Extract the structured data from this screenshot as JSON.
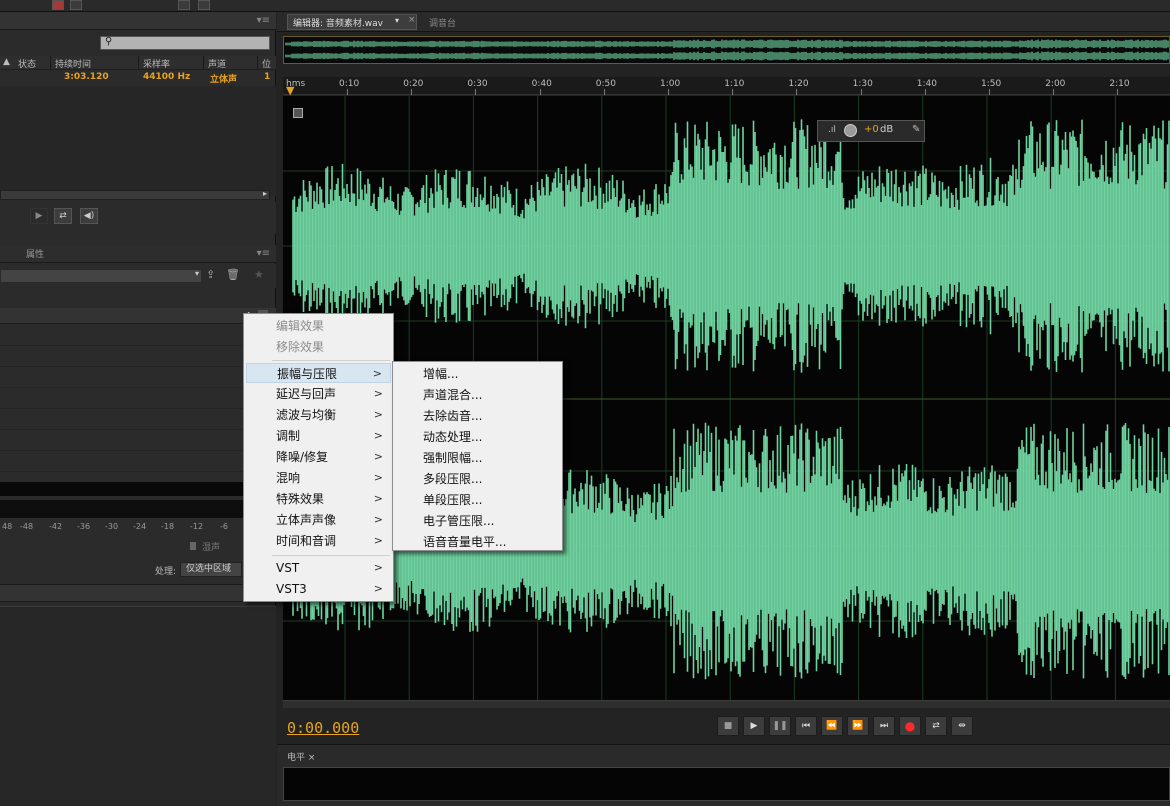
{
  "files_panel": {
    "headers": [
      "状态",
      "持续时间",
      "采样率",
      "声道",
      "位"
    ],
    "row": {
      "duration": "3:03.120",
      "sample_rate": "44100 Hz",
      "channels": "立体声",
      "bits": "1"
    }
  },
  "effects_panel": {
    "tabs": [
      "属性"
    ],
    "mix_label": "湿声",
    "process_label": "处理:",
    "process_value": "仅选中区域"
  },
  "meter_scale_db": [
    "48",
    "-48",
    "-42",
    "-36",
    "-30",
    "-24",
    "-18",
    "-12",
    "-6"
  ],
  "editor": {
    "tab_label": "编辑器: 音频素材.wav",
    "mixer_tab": "调音台",
    "time_readout": "0:00.000",
    "ruler_ticks": [
      "hms",
      "0:10",
      "0:20",
      "0:30",
      "0:40",
      "0:50",
      "1:00",
      "1:10",
      "1:20",
      "1:30",
      "1:40",
      "1:50",
      "2:00",
      "2:10"
    ],
    "hud": {
      "value": "+0",
      "unit": "dB"
    }
  },
  "levels_panel": {
    "tab_label": "电平"
  },
  "context_menu": {
    "items_top": [
      "编辑效果",
      "移除效果"
    ],
    "items_main": [
      "振幅与压限",
      "延迟与回声",
      "滤波与均衡",
      "调制",
      "降噪/修复",
      "混响",
      "特殊效果",
      "立体声声像",
      "时间和音调"
    ],
    "items_plugins": [
      "VST",
      "VST3"
    ],
    "submenu_indicator": ">"
  },
  "submenu": {
    "parent": "振幅与压限",
    "items": [
      "增幅...",
      "声道混合...",
      "去除齿音...",
      "动态处理...",
      "强制限幅...",
      "多段压限...",
      "单段压限...",
      "电子管压限...",
      "语音音量电平..."
    ]
  },
  "colors": {
    "waveform": "#6fd3a0",
    "accent": "#e8a320",
    "background": "#232323",
    "menu_highlight": "#d8e6f2"
  }
}
